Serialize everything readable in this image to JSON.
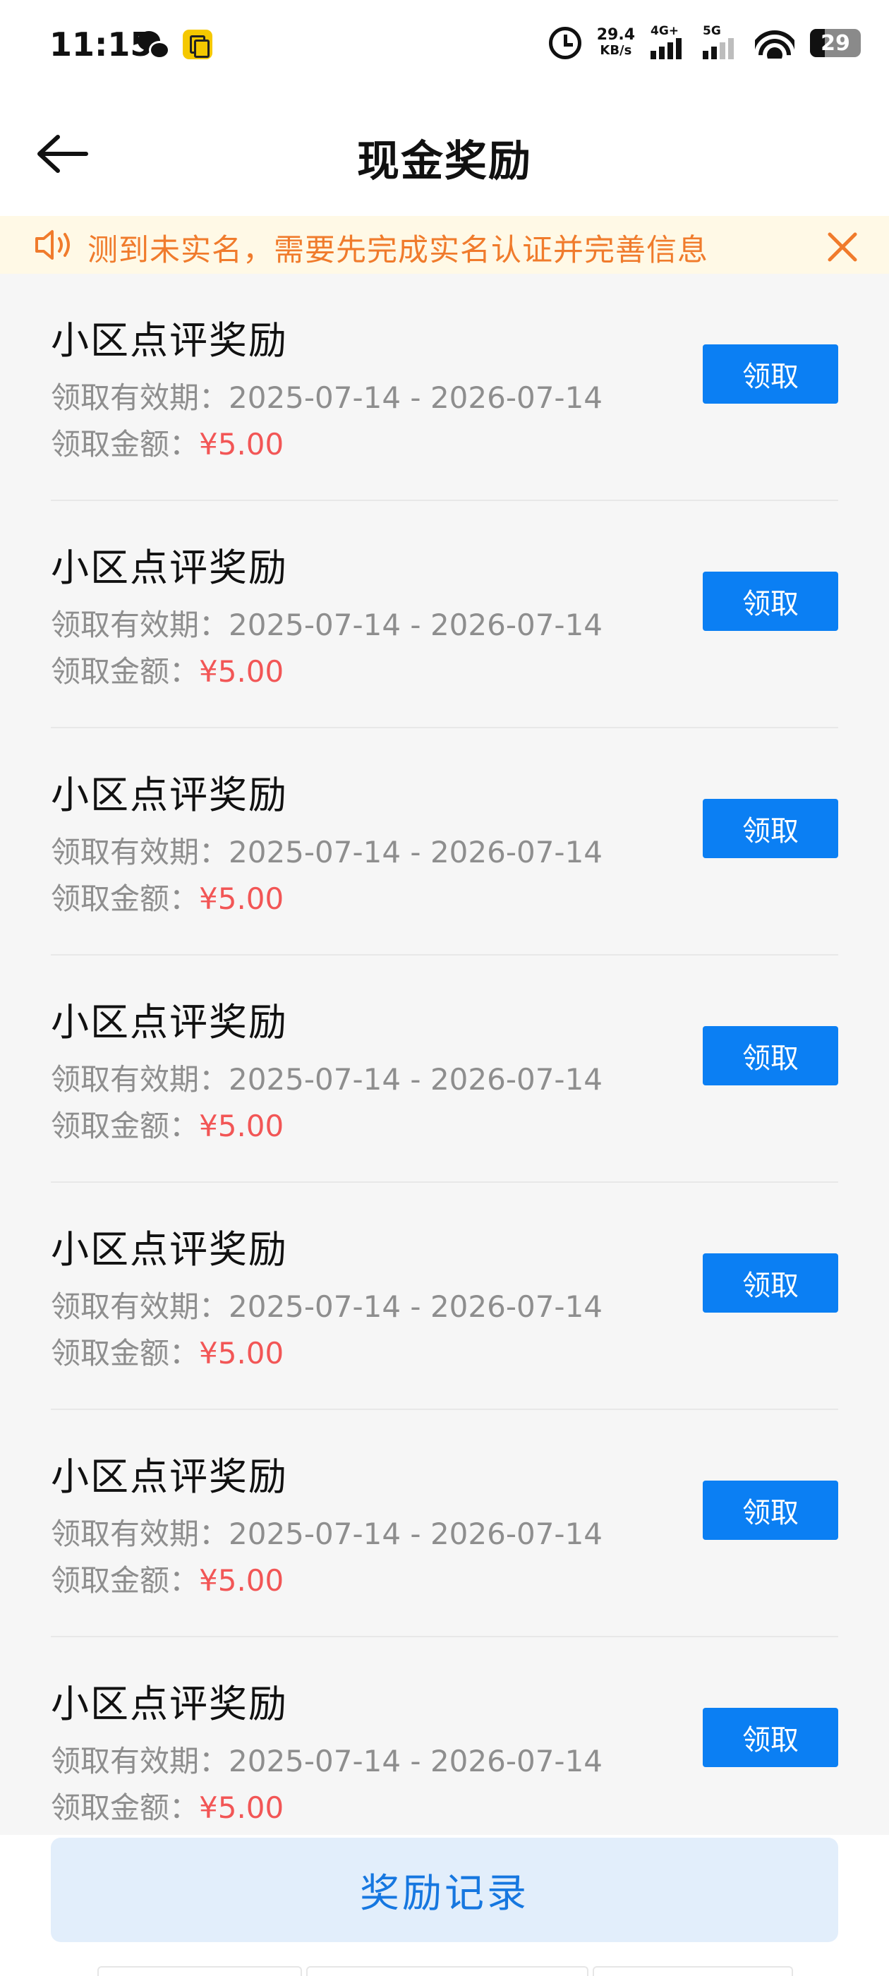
{
  "status_bar": {
    "time": "11:15",
    "net_speed_value": "29.4",
    "net_speed_unit": "KB/s",
    "signal1_label": "4G+",
    "signal2_label": "5G",
    "battery_level": "29"
  },
  "header": {
    "title": "现金奖励"
  },
  "notice": {
    "text": "测到未实名，需要先完成实名认证并完善信息",
    "color": "#f07b2c"
  },
  "rewards": [
    {
      "title": "小区点评奖励",
      "validity": "领取有效期：2025-07-14 - 2026-07-14",
      "amount_label": "领取金额：",
      "amount": "¥5.00",
      "button": "领取"
    },
    {
      "title": "小区点评奖励",
      "validity": "领取有效期：2025-07-14 - 2026-07-14",
      "amount_label": "领取金额：",
      "amount": "¥5.00",
      "button": "领取"
    },
    {
      "title": "小区点评奖励",
      "validity": "领取有效期：2025-07-14 - 2026-07-14",
      "amount_label": "领取金额：",
      "amount": "¥5.00",
      "button": "领取"
    },
    {
      "title": "小区点评奖励",
      "validity": "领取有效期：2025-07-14 - 2026-07-14",
      "amount_label": "领取金额：",
      "amount": "¥5.00",
      "button": "领取"
    },
    {
      "title": "小区点评奖励",
      "validity": "领取有效期：2025-07-14 - 2026-07-14",
      "amount_label": "领取金额：",
      "amount": "¥5.00",
      "button": "领取"
    },
    {
      "title": "小区点评奖励",
      "validity": "领取有效期：2025-07-14 - 2026-07-14",
      "amount_label": "领取金额：",
      "amount": "¥5.00",
      "button": "领取"
    },
    {
      "title": "小区点评奖励",
      "validity": "领取有效期：2025-07-14 - 2026-07-14",
      "amount_label": "领取金额：",
      "amount": "¥5.00",
      "button": "领取"
    }
  ],
  "footer": {
    "record_button": "奖励记录"
  },
  "colors": {
    "primary": "#0b7ff3",
    "amount": "#f25656",
    "notice_bg": "#fff9e6"
  }
}
